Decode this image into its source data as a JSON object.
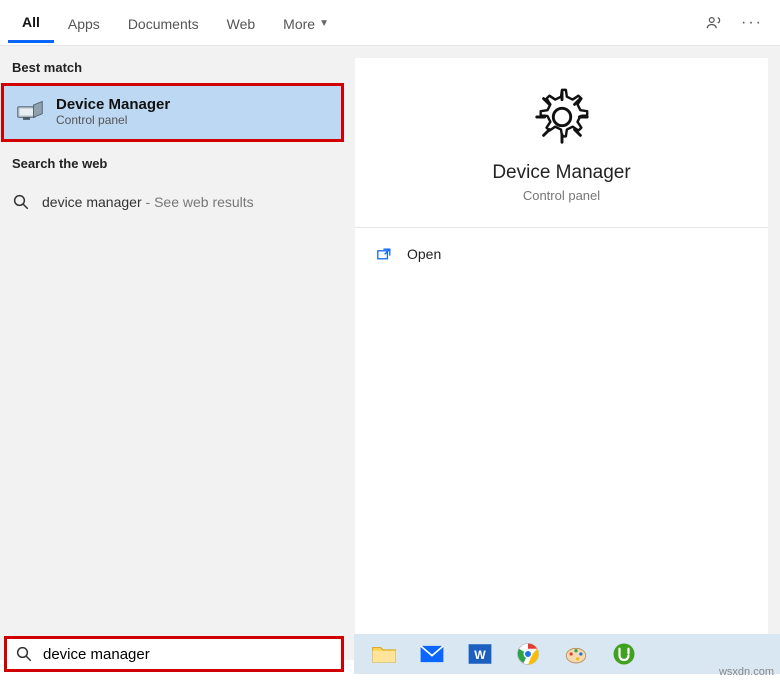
{
  "tabs": {
    "all": "All",
    "apps": "Apps",
    "documents": "Documents",
    "web": "Web",
    "more": "More"
  },
  "left": {
    "best_match_header": "Best match",
    "best_match": {
      "title": "Device Manager",
      "subtitle": "Control panel"
    },
    "search_web_header": "Search the web",
    "web_result": {
      "query": "device manager",
      "suffix": " - See web results"
    }
  },
  "right": {
    "title": "Device Manager",
    "subtitle": "Control panel",
    "open": "Open"
  },
  "search": {
    "value": "device manager",
    "placeholder": ""
  },
  "taskbar_icons": [
    "file-explorer",
    "mail",
    "word",
    "chrome",
    "paint",
    "utorrent"
  ],
  "watermark": "wsxdn.com"
}
